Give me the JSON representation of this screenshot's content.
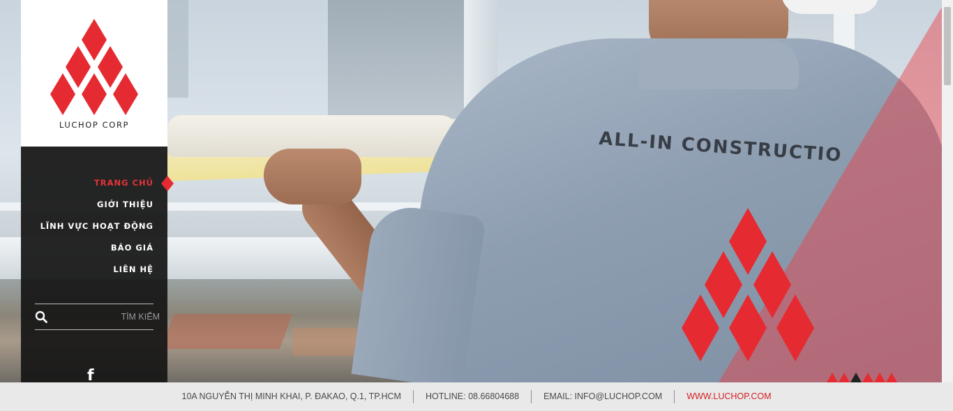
{
  "brand": {
    "name": "LUCHOP CORP",
    "accent": "#e52b31"
  },
  "hero": {
    "slogan": "ALL-IN CONSTRUCTIO"
  },
  "nav": {
    "items": [
      {
        "label": "TRANG CHỦ",
        "active": true
      },
      {
        "label": "GIỚI THIỆU",
        "active": false
      },
      {
        "label": "LĨNH VỰC HOẠT ĐỘNG",
        "active": false
      },
      {
        "label": "BÁO GIÁ",
        "active": false
      },
      {
        "label": "LIÊN HỆ",
        "active": false
      }
    ]
  },
  "search": {
    "placeholder": "TÌM KIẾM",
    "icon": "search-icon"
  },
  "social": {
    "facebook": "f"
  },
  "slider": {
    "count": 6,
    "active_index": 2
  },
  "footer": {
    "address": "10A NGUYỄN THỊ MINH KHAI, P. ĐAKAO, Q.1, TP.HCM",
    "hotline": "HOTLINE: 08.66804688",
    "email": "EMAIL: INFO@LUCHOP.COM",
    "website": "WWW.LUCHOP.COM"
  }
}
